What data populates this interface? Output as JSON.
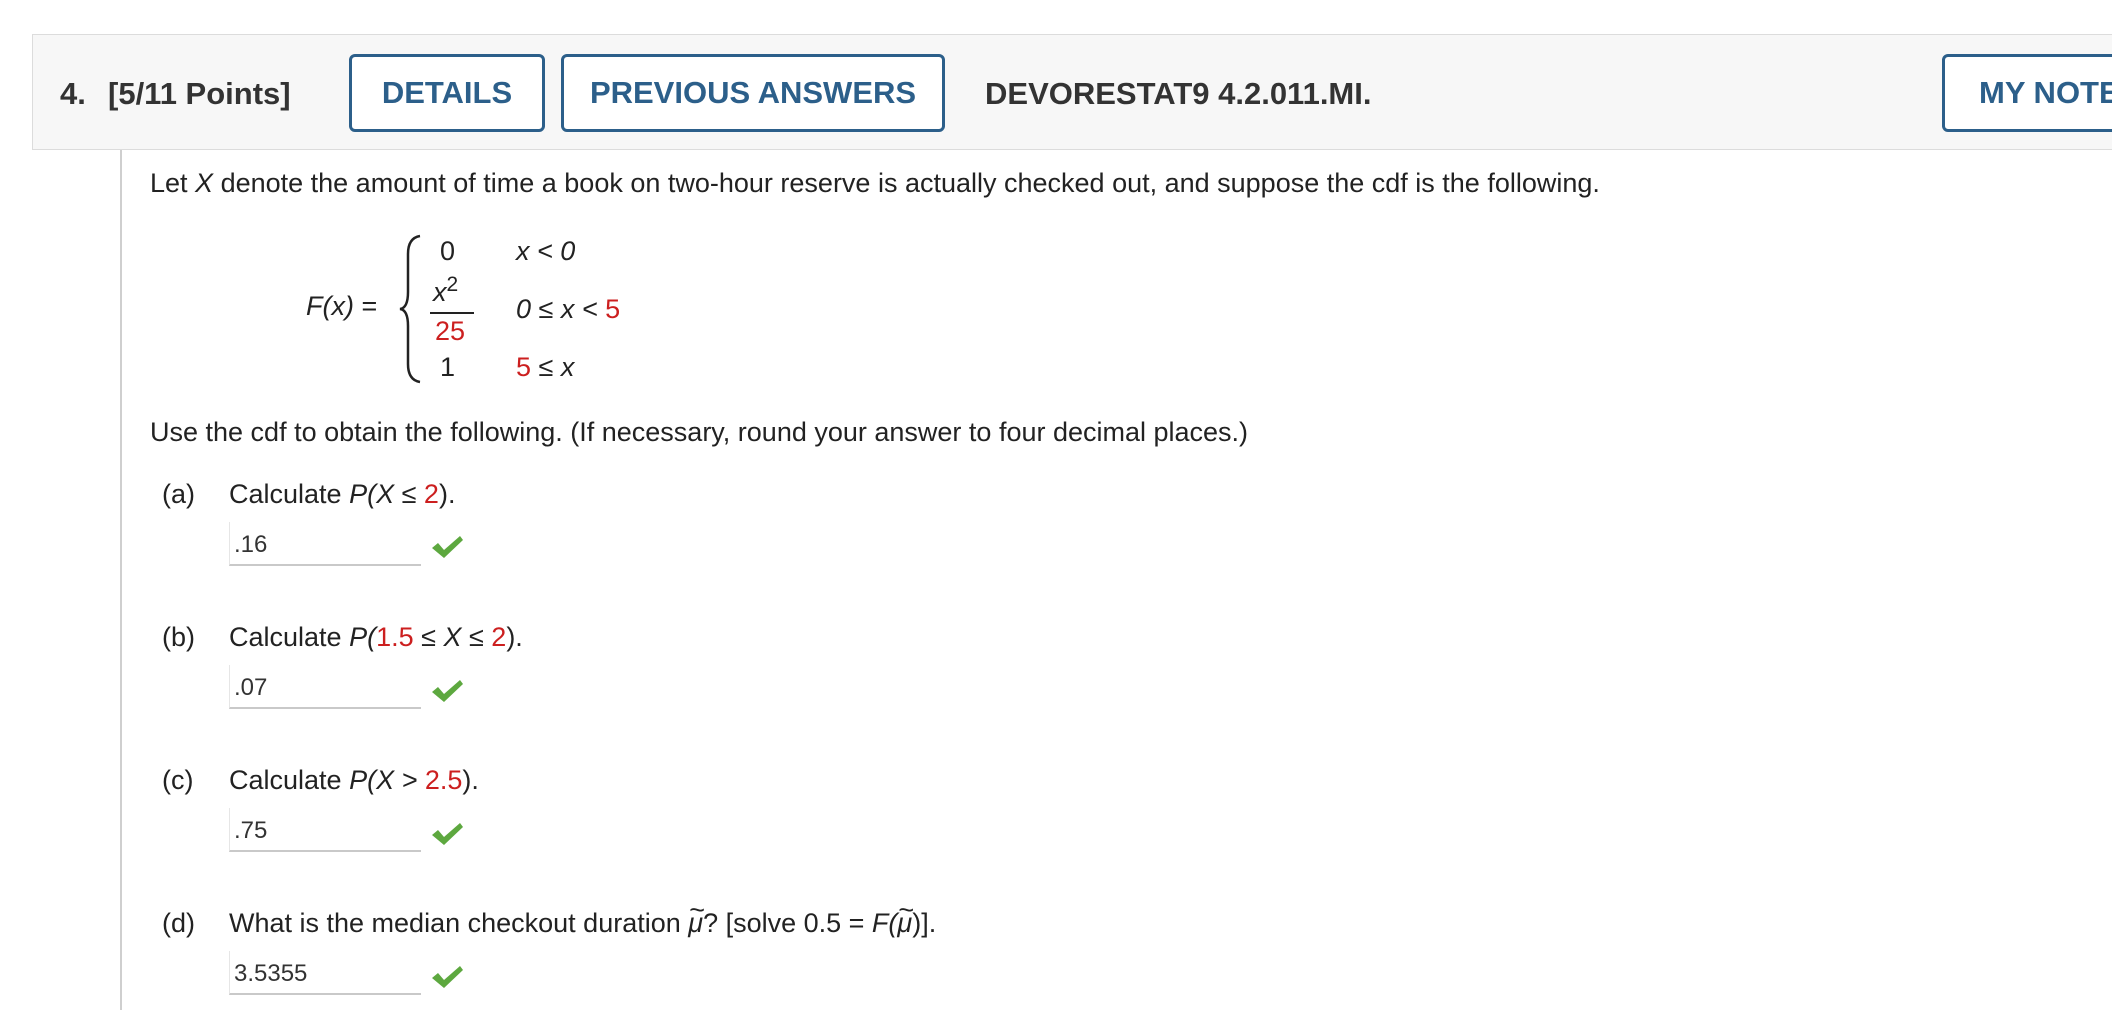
{
  "header": {
    "question_number": "4.",
    "points": "[5/11 Points]",
    "details_label": "DETAILS",
    "previous_answers_label": "PREVIOUS ANSWERS",
    "question_code": "DEVORESTAT9 4.2.011.MI.",
    "my_notes_label": "MY NOTE"
  },
  "intro": {
    "p1": "Let ",
    "var": "X",
    "p2": " denote the amount of time a book on two-hour reserve is actually checked out, and suppose the cdf is the following."
  },
  "cdf": {
    "lhs": "F(x)",
    "eq": "=",
    "case1_value": "0",
    "case1_cond": "x < 0",
    "case2_num": "x",
    "case2_exp": "2",
    "case2_den": "25",
    "case2_cond_a": "0 ≤ x < ",
    "case2_cond_b": "5",
    "case3_value": "1",
    "case3_cond_a": "5",
    "case3_cond_b": " ≤ x"
  },
  "instructions": "Use the cdf to obtain the following. (If necessary, round your answer to four decimal places.)",
  "parts": [
    {
      "label": "(a)",
      "prompt_a": "Calculate ",
      "prompt_b": "P(X ≤ ",
      "red": "2",
      "prompt_c": ").",
      "answer": ".16"
    },
    {
      "label": "(b)",
      "prompt_a": "Calculate ",
      "prompt_b": "P(",
      "red": "1.5",
      "prompt_c": " ≤ X ≤ ",
      "red2": "2",
      "prompt_d": ").",
      "answer": ".07"
    },
    {
      "label": "(c)",
      "prompt_a": "Calculate ",
      "prompt_b": "P(X > ",
      "red": "2.5",
      "prompt_c": ").",
      "answer": ".75"
    },
    {
      "label": "(d)",
      "prompt_a": "What is the median checkout duration ",
      "mu": "μ",
      "prompt_b": "? [solve 0.5 = ",
      "prompt_c": "F(",
      "prompt_d": ")].",
      "answer": "3.5355"
    }
  ],
  "colors": {
    "accent": "#2c5f8a",
    "highlight": "#cc1f1f",
    "correct": "#5da83f"
  }
}
